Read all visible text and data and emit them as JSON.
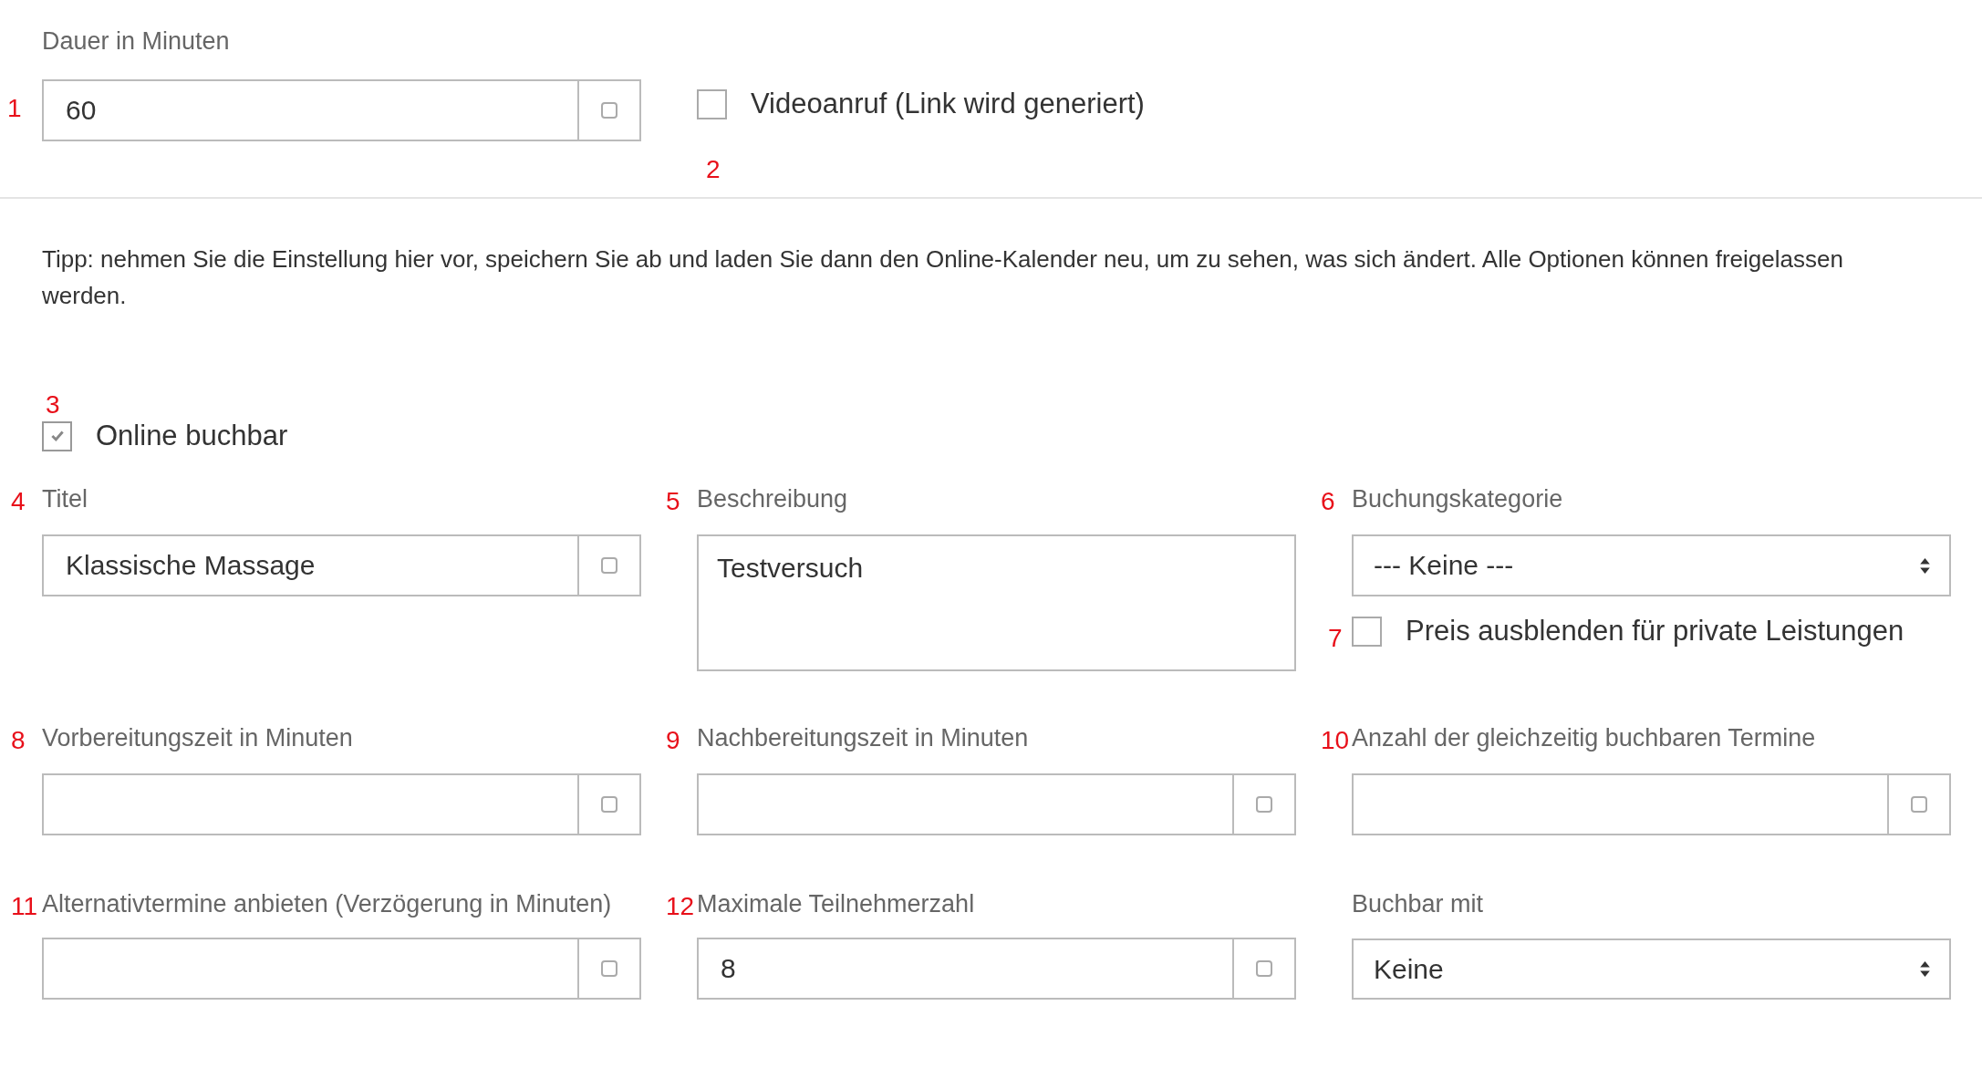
{
  "duration": {
    "marker": "1",
    "label": "Dauer in Minuten",
    "value": "60"
  },
  "video": {
    "marker": "2",
    "label": "Videoanruf (Link wird generiert)",
    "checked": false
  },
  "tip": "Tipp: nehmen Sie die Einstellung hier vor, speichern Sie ab und laden Sie dann den Online-Kalender neu, um zu sehen, was sich ändert. Alle Optionen können freigelassen werden.",
  "online": {
    "marker": "3",
    "label": "Online buchbar",
    "checked": true
  },
  "fields": [
    {
      "kind": "input",
      "marker": "4",
      "label": "Titel",
      "value": "Klassische Massage"
    },
    {
      "kind": "textarea",
      "marker": "5",
      "label": "Beschreibung",
      "value": "Testversuch"
    },
    {
      "kind": "select",
      "marker": "6",
      "label": "Buchungskategorie",
      "value": "--- Keine ---",
      "checkbox": {
        "marker": "7",
        "label": "Preis ausblenden für private Leistungen",
        "checked": false
      }
    },
    {
      "kind": "input",
      "marker": "8",
      "label": "Vorbereitungszeit in Minuten"
    },
    {
      "kind": "input",
      "marker": "9",
      "label": "Nachbereitungszeit in Minuten"
    },
    {
      "kind": "input",
      "marker": "10",
      "label": "Anzahl der gleichzeitig buchbaren Termine"
    },
    {
      "kind": "input",
      "marker": "11",
      "label": "Alternativtermine anbieten (Verzögerung in Minuten)"
    },
    {
      "kind": "input",
      "marker": "12",
      "label": "Maximale Teilnehmerzahl",
      "value": "8"
    },
    {
      "kind": "select",
      "label": "Buchbar mit",
      "value": "Keine"
    }
  ]
}
